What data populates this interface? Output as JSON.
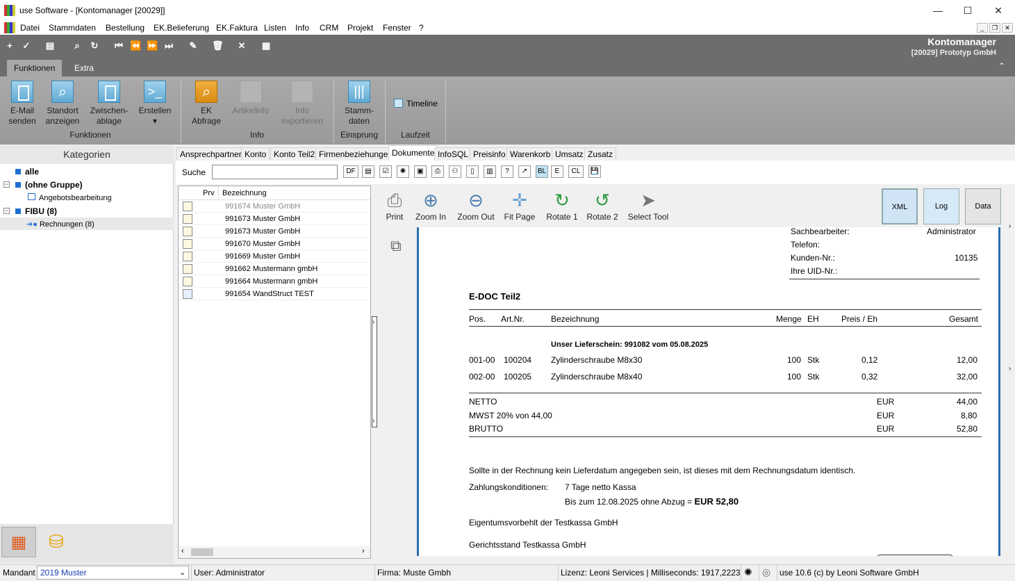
{
  "window": {
    "title": "use Software - [Kontomanager [20029]]",
    "controls": [
      "—",
      "☐",
      "✕"
    ]
  },
  "menu": [
    "Datei",
    "Stammdaten",
    "Bestellung",
    "EK.Belieferung",
    "EK.Faktura",
    "Listen",
    "Info",
    "CRM",
    "Projekt",
    "Fenster",
    "?"
  ],
  "brand": {
    "title": "Kontomanager",
    "subtitle": "[20029] Prototyp GmbH"
  },
  "ribbon_tabs": [
    "Funktionen",
    "Extra"
  ],
  "ribbon": {
    "buttons": [
      {
        "l1": "E-Mail",
        "l2": "senden"
      },
      {
        "l1": "Standort",
        "l2": "anzeigen"
      },
      {
        "l1": "Zwischen-",
        "l2": "ablage"
      },
      {
        "l1": "Erstellen",
        "l2": "▾"
      },
      {
        "l1": "EK",
        "l2": "Abfrage"
      },
      {
        "l1": "Artikelinfo",
        "l2": ""
      },
      {
        "l1": "Info",
        "l2": "exportieren"
      },
      {
        "l1": "Stamm-",
        "l2": "daten"
      }
    ],
    "groups": [
      "Funktionen",
      "Info",
      "Einsprung",
      "Laufzeit"
    ],
    "timeline": "Timeline"
  },
  "left": {
    "header": "Kategorien",
    "tree": [
      "alle",
      "(ohne Gruppe)",
      "Angebotsbearbeitung",
      "FIBU (8)",
      "Rechnungen (8)"
    ]
  },
  "tabs": [
    "Ansprechpartner",
    "Konto",
    "Konto Teil2",
    "Firmenbeziehungen",
    "Dokumente",
    "InfoSQL",
    "Preisinfo",
    "Warenkorb",
    "Umsatz",
    "Zusatz"
  ],
  "search": {
    "label": "Suche",
    "value": "",
    "btns": [
      "DF",
      "BL",
      "E",
      "CL"
    ]
  },
  "list": {
    "headers": [
      "Prv",
      "Bezeichnung"
    ],
    "rows": [
      "991674 Muster GmbH",
      "991673 Muster GmbH",
      "991673 Muster GmbH",
      "991670 Muster GmbH",
      "991669 Muster GmbH",
      "991662 Mustermann gmbH",
      "991664 Mustermann gmbH",
      "991654 WandStruct TEST"
    ]
  },
  "viewer": {
    "tools": [
      "Print",
      "Zoom In",
      "Zoom Out",
      "Fit Page",
      "Rotate 1",
      "Rotate 2",
      "Select Tool"
    ],
    "boxes": [
      "XML",
      "Log",
      "Data"
    ]
  },
  "doc": {
    "info_labels": [
      "Sachbearbeiter:",
      "Telefon:",
      "Kunden-Nr.:",
      "Ihre UID-Nr.:"
    ],
    "info_values": [
      "Administrator",
      "",
      "10135",
      ""
    ],
    "title": "E-DOC Teil2",
    "cols": [
      "Pos.",
      "Art.Nr.",
      "Bezeichnung",
      "Menge",
      "EH",
      "Preis / Eh",
      "Gesamt"
    ],
    "delivery": "Unser Lieferschein: 991082 vom 05.08.2025",
    "items": [
      {
        "pos": "001-00",
        "art": "100204",
        "bez": "Zylinderschraube M8x30",
        "menge": "100",
        "eh": "Stk",
        "preis": "0,12",
        "gesamt": "12,00"
      },
      {
        "pos": "002-00",
        "art": "100205",
        "bez": "Zylinderschraube M8x40",
        "menge": "100",
        "eh": "Stk",
        "preis": "0,32",
        "gesamt": "32,00"
      }
    ],
    "totals": [
      {
        "label": "NETTO",
        "cur": "EUR",
        "val": "44,00"
      },
      {
        "label": "MWST 20% von 44,00",
        "cur": "EUR",
        "val": "8,80"
      },
      {
        "label": "BRUTTO",
        "cur": "EUR",
        "val": "52,80"
      }
    ],
    "note": "Sollte in der Rechnung kein Lieferdatum angegeben sein, ist dieses mit dem Rechnungsdatum identisch.",
    "zk_label": "Zahlungskonditionen:",
    "zk1": "7 Tage netto Kassa",
    "zk2": "Bis zum 12.08.2025 ohne Abzug =",
    "zk2_amount": "EUR  52,80",
    "ownership": "Eigentumsvorbehlt der Testkassa GmbH",
    "court": "Gerichtsstand Testkassa GmbH"
  },
  "status": {
    "mandant_label": "Mandant",
    "mandant_value": "2019 Muster",
    "user": "User: Administrator",
    "firma": "Firma: Muste Gmbh",
    "lizenz": "Lizenz: Leoni Services | Milliseconds: 1917,2223",
    "version": "use 10.6 (c) by Leoni Software GmbH"
  }
}
